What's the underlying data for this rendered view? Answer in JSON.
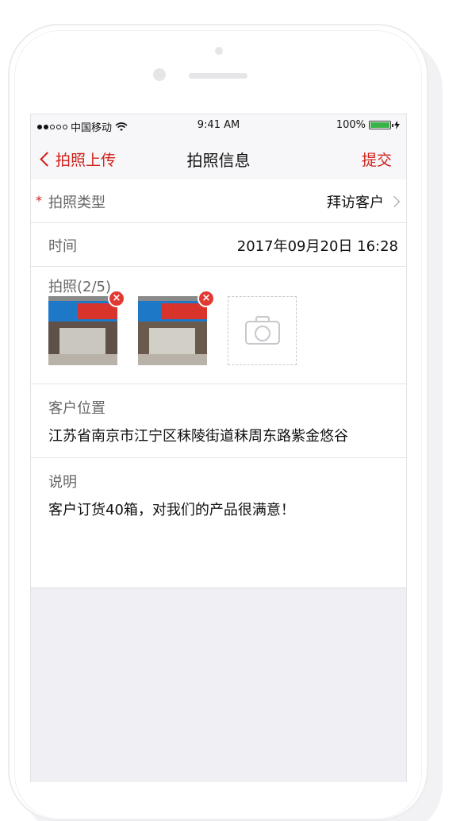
{
  "status_bar": {
    "carrier": "中国移动",
    "time": "9:41 AM",
    "battery": "100%"
  },
  "nav": {
    "back_label": "拍照上传",
    "title": "拍照信息",
    "submit_label": "提交"
  },
  "form": {
    "photo_type": {
      "label": "拍照类型",
      "required_mark": "*",
      "value": "拜访客户"
    },
    "time": {
      "label": "时间",
      "value": "2017年09月20日 16:28"
    },
    "photos": {
      "label": "拍照(2/5)",
      "items": [
        {
          "alt": "storefront-photo-1",
          "delete_glyph": "×"
        },
        {
          "alt": "storefront-photo-2",
          "delete_glyph": "×"
        }
      ]
    },
    "location": {
      "label": "客户位置",
      "value": "江苏省南京市江宁区秣陵街道秣周东路紫金悠谷"
    },
    "description": {
      "label": "说明",
      "value": "客户订货40箱，对我们的产品很满意！"
    }
  },
  "colors": {
    "accent": "#d0201a",
    "delete": "#e23a33",
    "battery": "#3cb34a"
  },
  "icons": {
    "back": "chevron-left-icon",
    "row_arrow": "chevron-right-icon",
    "wifi": "wifi-icon",
    "add_photo": "camera-icon",
    "delete": "close-icon"
  }
}
